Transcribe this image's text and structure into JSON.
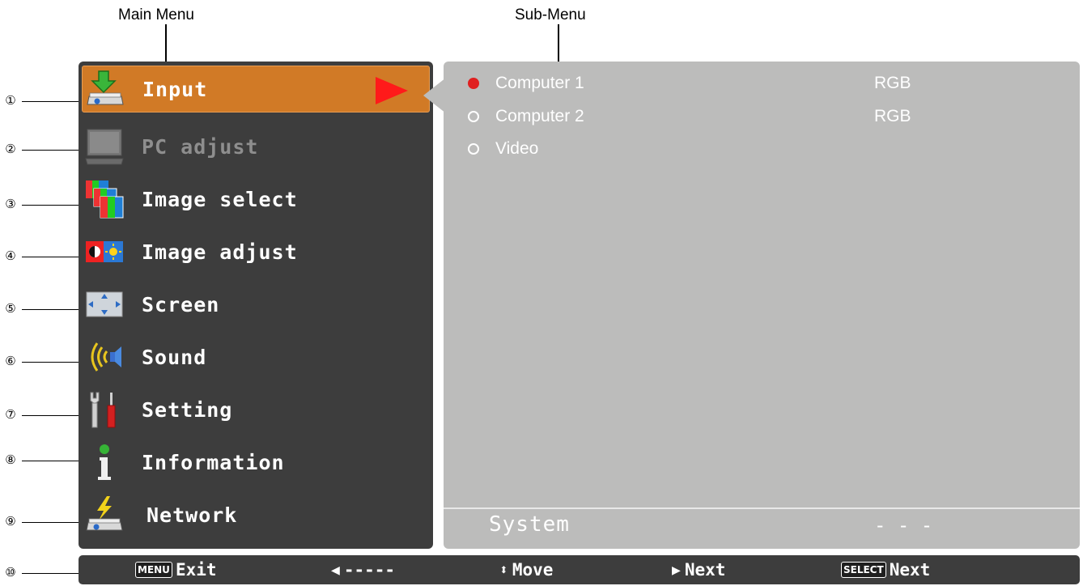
{
  "callouts": {
    "main_menu": "Main Menu",
    "sub_menu": "Sub-Menu",
    "numbers": [
      "①",
      "②",
      "③",
      "④",
      "⑤",
      "⑥",
      "⑦",
      "⑧",
      "⑨",
      "⑩"
    ]
  },
  "main_menu": {
    "items": [
      {
        "label": "Input",
        "icon": "input-icon",
        "selected": true
      },
      {
        "label": "PC adjust",
        "icon": "pc-adjust-icon",
        "disabled": true
      },
      {
        "label": "Image select",
        "icon": "image-select-icon"
      },
      {
        "label": "Image adjust",
        "icon": "image-adjust-icon"
      },
      {
        "label": "Screen",
        "icon": "screen-icon"
      },
      {
        "label": "Sound",
        "icon": "sound-icon"
      },
      {
        "label": "Setting",
        "icon": "setting-icon"
      },
      {
        "label": "Information",
        "icon": "information-icon"
      },
      {
        "label": "Network",
        "icon": "network-icon"
      }
    ],
    "accent_color": "#d17a26"
  },
  "sub_menu": {
    "options": [
      {
        "name": "Computer 1",
        "value": "RGB",
        "selected": true
      },
      {
        "name": "Computer 2",
        "value": "RGB",
        "selected": false
      },
      {
        "name": "Video",
        "value": "",
        "selected": false
      }
    ],
    "system_label": "System",
    "system_value": "- - -"
  },
  "guide_bar": {
    "menu_key": "MENU",
    "exit_label": "Exit",
    "back_label": "-----",
    "move_label": "Move",
    "next_label": "Next",
    "select_key": "SELECT",
    "select_next_label": "Next"
  }
}
